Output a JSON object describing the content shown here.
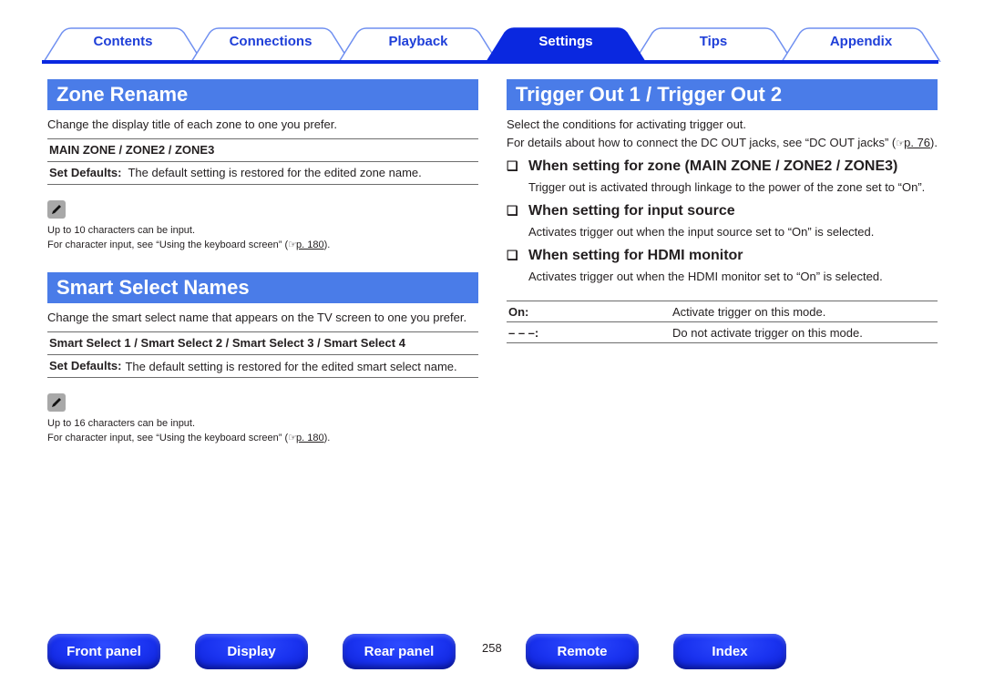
{
  "tabs": [
    {
      "label": "Contents",
      "active": false
    },
    {
      "label": "Connections",
      "active": false
    },
    {
      "label": "Playback",
      "active": false
    },
    {
      "label": "Settings",
      "active": true
    },
    {
      "label": "Tips",
      "active": false
    },
    {
      "label": "Appendix",
      "active": false
    }
  ],
  "colors": {
    "accent": "#0a28e0",
    "section_header": "#4a7ce8",
    "tab_text": "#1f3fd8"
  },
  "zone_rename": {
    "title": "Zone Rename",
    "intro": "Change the display title of each zone to one you prefer.",
    "item": "MAIN ZONE / ZONE2 / ZONE3",
    "set_defaults_label": "Set Defaults:",
    "set_defaults_text": "The default setting is restored for the edited zone name.",
    "note_icon": "pencil-icon",
    "note_line1": "Up to 10 characters can be input.",
    "note_line2_pre": "For character input, see “Using the keyboard screen” (",
    "note_ref": "p. 180",
    "note_line2_post": ")."
  },
  "smart_select": {
    "title": "Smart Select Names",
    "intro": "Change the smart select name that appears on the TV screen to one you prefer.",
    "item": "Smart Select 1 / Smart Select 2 / Smart Select 3 / Smart Select 4",
    "set_defaults_label": "Set Defaults:",
    "set_defaults_text": "The default setting is restored for the edited smart select name.",
    "note_icon": "pencil-icon",
    "note_line1": "Up to 16 characters can be input.",
    "note_line2_pre": "For character input, see “Using the keyboard screen” (",
    "note_ref": "p. 180",
    "note_line2_post": ")."
  },
  "trigger_out": {
    "title": "Trigger Out 1 / Trigger Out 2",
    "intro1": "Select the conditions for activating trigger out.",
    "intro2_pre": "For details about how to connect the DC OUT jacks, see “DC OUT jacks” (",
    "intro2_ref": "p. 76",
    "intro2_post": ").",
    "subsections": [
      {
        "heading": "When setting for zone (MAIN ZONE / ZONE2 / ZONE3)",
        "body": "Trigger out is activated through linkage to the power of the zone set to “On”."
      },
      {
        "heading": "When setting for input source",
        "body": "Activates trigger out when the input source set to “On” is selected."
      },
      {
        "heading": "When setting for HDMI monitor",
        "body": "Activates trigger out when the HDMI monitor set to “On” is selected."
      }
    ],
    "options": [
      {
        "key": "On:",
        "value": "Activate trigger on this mode."
      },
      {
        "key": "– – –:",
        "value": "Do not activate trigger on this mode."
      }
    ]
  },
  "footer": {
    "buttons": [
      "Front panel",
      "Display",
      "Rear panel",
      "Remote",
      "Index"
    ],
    "page_number": "258"
  }
}
